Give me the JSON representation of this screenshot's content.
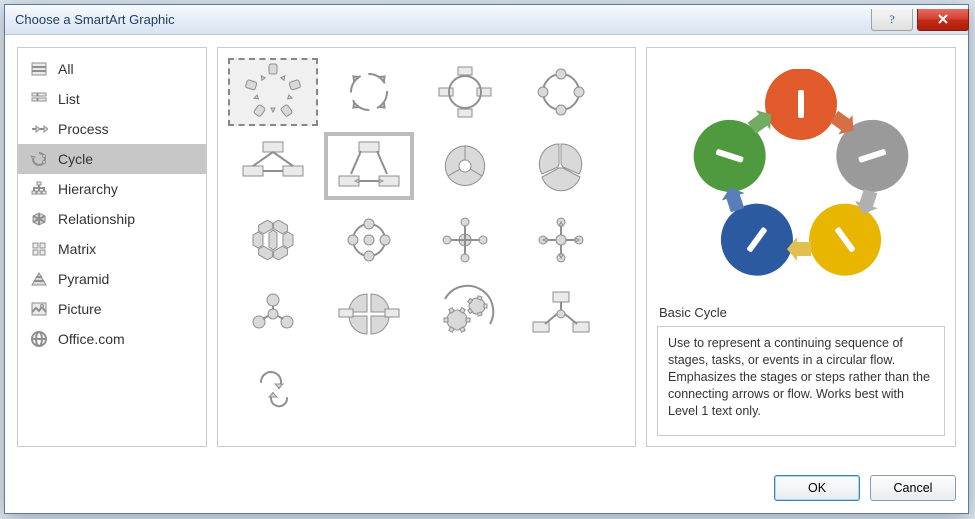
{
  "dialog": {
    "title": "Choose a SmartArt Graphic"
  },
  "categories": [
    {
      "label": "All"
    },
    {
      "label": "List"
    },
    {
      "label": "Process"
    },
    {
      "label": "Cycle"
    },
    {
      "label": "Hierarchy"
    },
    {
      "label": "Relationship"
    },
    {
      "label": "Matrix"
    },
    {
      "label": "Pyramid"
    },
    {
      "label": "Picture"
    },
    {
      "label": "Office.com"
    }
  ],
  "selected_category_index": 3,
  "preview": {
    "title": "Basic Cycle",
    "description": "Use to represent a continuing sequence of stages, tasks, or events in a circular flow. Emphasizes the stages or steps rather than the connecting arrows or flow. Works best with Level 1 text only.",
    "nodes": [
      {
        "color": "#e05a2b"
      },
      {
        "color": "#9a9a9a"
      },
      {
        "color": "#e8b500"
      },
      {
        "color": "#2c5aa0"
      },
      {
        "color": "#4f9a3e"
      }
    ]
  },
  "buttons": {
    "ok": "OK",
    "cancel": "Cancel"
  }
}
